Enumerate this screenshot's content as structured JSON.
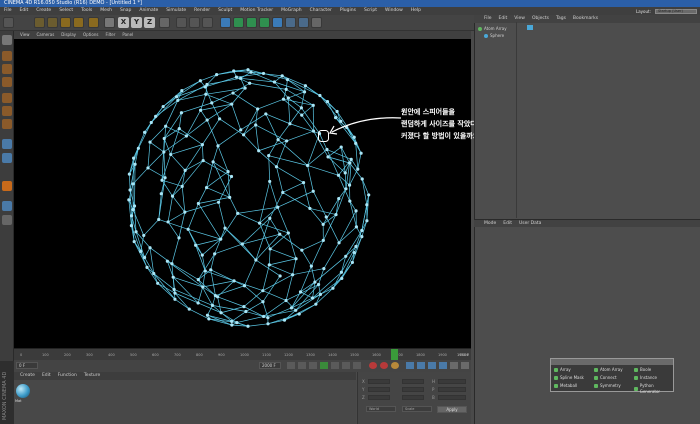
{
  "title_bar": {
    "text": "CINEMA 4D R16.050 Studio (R16) DEMO - [Untitled 1 *]"
  },
  "menu": [
    "File",
    "Edit",
    "Create",
    "Select",
    "Tools",
    "Mesh",
    "Snap",
    "Animate",
    "Simulate",
    "Render",
    "Sculpt",
    "Motion Tracker",
    "MoGraph",
    "Character",
    "Plugins",
    "Script",
    "Window",
    "Help"
  ],
  "layout": {
    "label": "Layout:",
    "value": "Startup (User)"
  },
  "viewport_menu": [
    "View",
    "Cameras",
    "Display",
    "Options",
    "Filter",
    "Panel"
  ],
  "object_manager": {
    "menu": [
      "File",
      "Edit",
      "View",
      "Objects",
      "Tags",
      "Bookmarks"
    ],
    "objects": [
      "Atom Array",
      "Sphere"
    ]
  },
  "attribute_manager": {
    "menu": [
      "Mode",
      "Edit",
      "User Data"
    ]
  },
  "material_menu": [
    "Create",
    "Edit",
    "Function",
    "Texture"
  ],
  "timeline": {
    "ticks": [
      "0",
      "50",
      "100",
      "150",
      "200",
      "250",
      "300",
      "350",
      "400",
      "450",
      "500",
      "550",
      "600",
      "650",
      "700",
      "750",
      "800",
      "850",
      "900",
      "950",
      "1000",
      "1050",
      "1100",
      "1150",
      "1200",
      "1250",
      "1300",
      "1350",
      "1400",
      "1450",
      "1500",
      "1550",
      "1600",
      "1650",
      "1700",
      "1750",
      "1800",
      "1850",
      "1900",
      "1950",
      "2000"
    ],
    "current_frame": "1700",
    "end_label": "1950 F",
    "start_field": "0 F",
    "end_field": "2000 F"
  },
  "coords": {
    "labels": [
      "X",
      "Y",
      "Z"
    ],
    "size_labels": [
      "H",
      "P",
      "B"
    ],
    "mode_world": "World",
    "mode_scale": "Scale",
    "apply": "Apply"
  },
  "mograph_palette": {
    "items": [
      {
        "label": "Array",
        "color": "#5fb85f"
      },
      {
        "label": "Atom Array",
        "color": "#5fb85f"
      },
      {
        "label": "Boole",
        "color": "#5fb85f"
      },
      {
        "label": "Spline Mask",
        "color": "#5fb85f"
      },
      {
        "label": "Connect",
        "color": "#5fb85f"
      },
      {
        "label": "Instance",
        "color": "#5fb85f"
      },
      {
        "label": "Metaball",
        "color": "#5fb85f"
      },
      {
        "label": "Symmetry",
        "color": "#5fb85f"
      },
      {
        "label": "Python Generator",
        "color": "#5fb85f"
      }
    ]
  },
  "annotation": {
    "lines": [
      "원안에 스피어들을",
      "랜덤하게 사이즈를 작았다",
      "커졌다 할 방법이 있을까요?"
    ]
  },
  "maxon_label": "MAXON CINEMA 4D",
  "colors": {
    "wire": "#5bc8e6",
    "accent": "#2b5fa8"
  }
}
